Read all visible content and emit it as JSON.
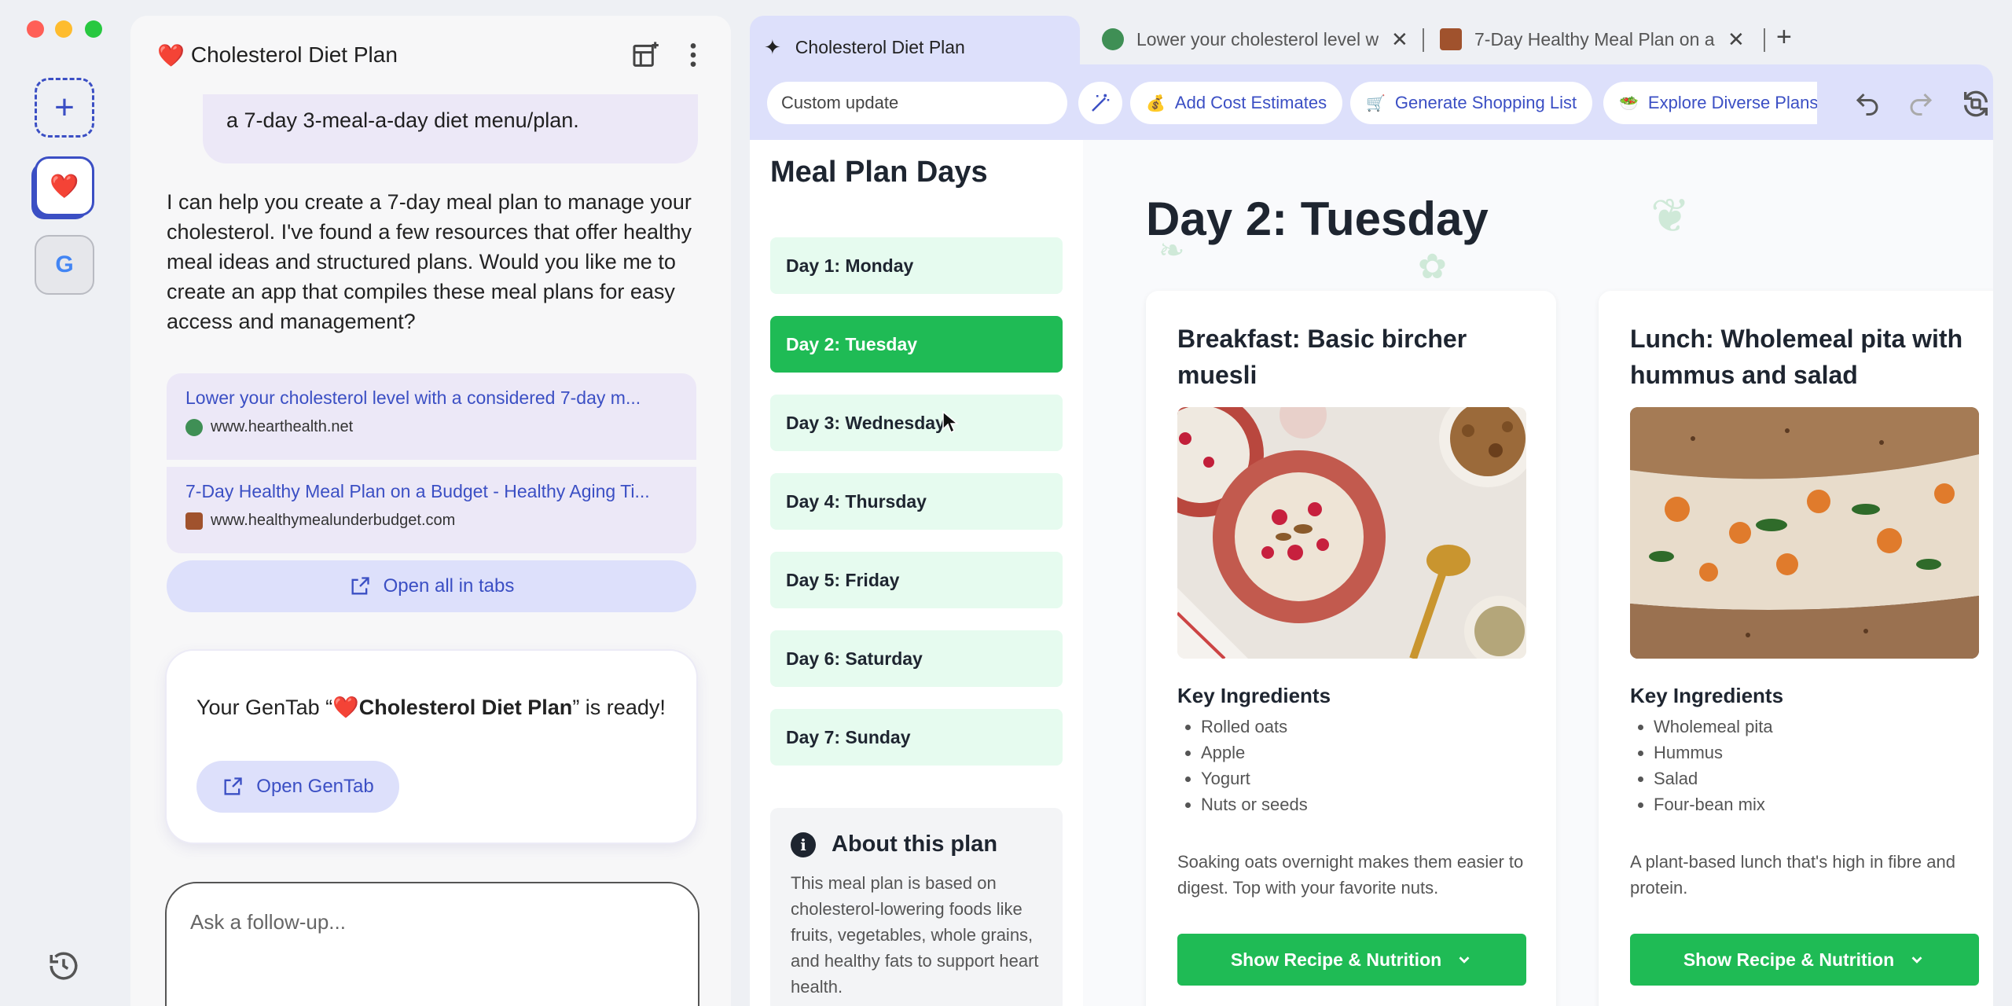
{
  "chat": {
    "title": "Cholesterol Diet Plan",
    "title_emoji": "❤️",
    "user_message": "a 7-day 3-meal-a-day diet menu/plan.",
    "reply": "I can help you create a 7-day meal plan to manage your cholesterol. I've found a few resources that offer healthy meal ideas and structured plans. Would you like me to create an app that compiles these meal plans for easy access and management?",
    "sources": [
      {
        "title": "Lower your cholesterol level with a considered 7-day m...",
        "url": "www.hearthealth.net"
      },
      {
        "title": "7-Day Healthy Meal Plan on a Budget - Healthy Aging Ti...",
        "url": "www.healthymealunderbudget.com"
      }
    ],
    "open_all_label": "Open all in tabs",
    "ready_prefix": "Your GenTab “",
    "ready_name": "❤️Cholesterol Diet Plan",
    "ready_suffix": "” is ready!",
    "open_gentab_label": "Open GenTab",
    "ask_placeholder": "Ask a follow-up..."
  },
  "rail": {
    "new_icon": "plus-icon",
    "heart": "❤️",
    "google": "G"
  },
  "tabs": [
    {
      "label": "Cholesterol Diet Plan",
      "active": true
    },
    {
      "label": "Lower your cholesterol level w",
      "active": false
    },
    {
      "label": "7-Day Healthy Meal Plan on a",
      "active": false
    }
  ],
  "toolbar": {
    "custom_update_placeholder": "Custom update",
    "chips": [
      {
        "icon": "💰",
        "label": "Add Cost Estimates"
      },
      {
        "icon": "🛒",
        "label": "Generate Shopping List"
      },
      {
        "icon": "🥗",
        "label": "Explore Diverse Plans"
      }
    ]
  },
  "page": {
    "sidebar_title": "Meal Plan Days",
    "days": [
      "Day 1: Monday",
      "Day 2: Tuesday",
      "Day 3: Wednesday",
      "Day 4: Thursday",
      "Day 5: Friday",
      "Day 6: Saturday",
      "Day 7: Sunday"
    ],
    "active_day_index": 1,
    "about_title": "About this plan",
    "about_text": "This meal plan is based on cholesterol-lowering foods like fruits, vegetables, whole grains, and healthy fats to support heart health.",
    "day_title": "Day 2: Tuesday",
    "meals": [
      {
        "title": "Breakfast: Basic bircher muesli",
        "key_ingredients_label": "Key Ingredients",
        "ingredients": [
          "Rolled oats",
          "Apple",
          "Yogurt",
          "Nuts or seeds"
        ],
        "description": "Soaking oats overnight makes them easier to digest. Top with your favorite nuts.",
        "button_label": "Show Recipe & Nutrition"
      },
      {
        "title": "Lunch: Wholemeal pita with hummus and salad",
        "key_ingredients_label": "Key Ingredients",
        "ingredients": [
          "Wholemeal pita",
          "Hummus",
          "Salad",
          "Four-bean mix"
        ],
        "description": "A plant-based lunch that's high in fibre and protein.",
        "button_label": "Show Recipe & Nutrition"
      }
    ]
  },
  "colors": {
    "accent": "#3b4fc4",
    "green": "#1fbb55",
    "lavender": "#dde0fb"
  }
}
